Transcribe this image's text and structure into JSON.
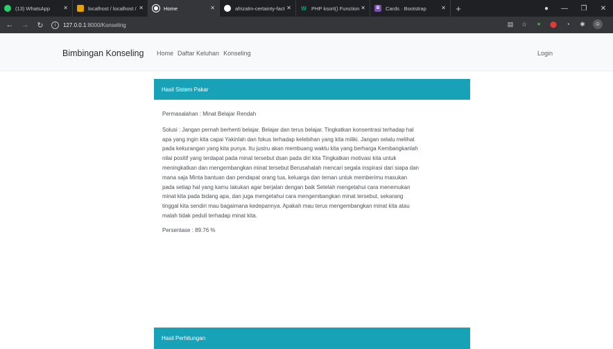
{
  "browser": {
    "tabs": [
      {
        "title": "(13) WhatsApp",
        "favicon_color": "#25d366",
        "favicon_text": ""
      },
      {
        "title": "localhost / localhost /",
        "favicon_color": "#e8a200",
        "favicon_text": ""
      },
      {
        "title": "Home",
        "favicon_color": "#ffffff",
        "favicon_text": ""
      },
      {
        "title": "afrizalm-certainty-fact",
        "favicon_color": "#ffffff",
        "favicon_text": ""
      },
      {
        "title": "PHP ksort() Function",
        "favicon_color": "#04aa6d",
        "favicon_text": "W"
      },
      {
        "title": "Cards · Bootstrap",
        "favicon_color": "#7952b3",
        "favicon_text": "B"
      }
    ],
    "tab_close_glyph": "✕",
    "new_tab_glyph": "+",
    "window_controls": {
      "minimize": "—",
      "maximize": "❐",
      "close": "✕"
    },
    "nav": {
      "back": "←",
      "forward": "→",
      "reload": "↻",
      "info": "i"
    },
    "url_host": "127.0.0.1",
    "url_rest": ":8000/Konseling"
  },
  "navbar": {
    "brand": "Bimbingan Konseling",
    "links": [
      "Home",
      "Daftar Keluhan",
      "Konseling"
    ],
    "login": "Login"
  },
  "result_card": {
    "header": "Hasil Sistem Pakar",
    "problem": "Permasalahan : Minat Belajar Rendah",
    "solution": "Solusi : Jangan pernah berhenti belajar. Belajar dan terus belajar. Tingkatkan konsentrasi terhadap hal apa yang ingin kita capai Yakinlah dan fokus terhadap kelebihan yang kita miliki. Jangan selalu melihat pada kekurangan yang kita punya. Itu justru akan membuang waktu kita yang berharga Kembangkanlah nilai positif yang terdapat pada minat tersebut dsan pada diri kita Tingkatkan motivasi kita untuk meningkatkan dan mengembangkan minat tersebut Berusahalah mencari segala inspirasi dari siapa dan mana saja Minta bantuan dan pendapat orang tua, keluarga dan teman untuk memberimu masukan pada setiap hal yang kamu lakukan agar berjalan dengan baik Setelah mengetahui cara menemukan minat kita pada bidang apa, dan juga mengetahui cara mengembangkan minat tersebut, sekarang tinggal kita sendiri mau bagaimana kedepannya. Apakah mau terus mengembangkan minat kita atau malah tidak peduli terhadap minat kita.",
    "percentage": "Persentase : 89.76 %"
  },
  "calc_card": {
    "header": "Hasil Perhitungan"
  }
}
